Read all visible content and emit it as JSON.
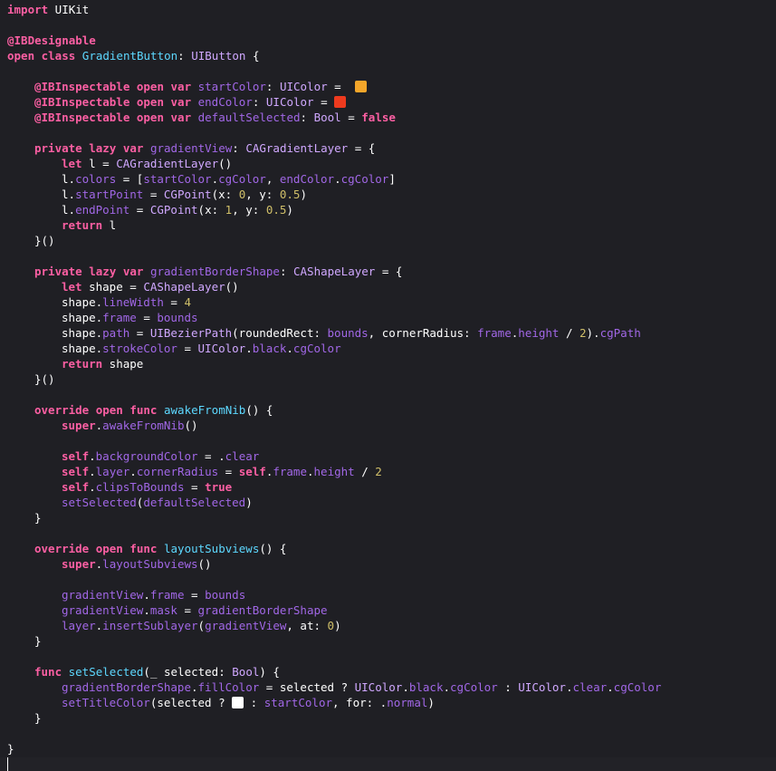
{
  "colors": {
    "start_swatch": "#f4a62a",
    "end_swatch": "#ee3a1e",
    "white_swatch": "#ffffff",
    "background": "#1f1f24"
  },
  "code": {
    "l1": {
      "kw": "import",
      "rest": " UIKit"
    },
    "l3": {
      "attr": "@IBDesignable"
    },
    "l4": {
      "kw": "open class",
      "cls": "GradientButton",
      "sep": ": ",
      "tp": "UIButton",
      "rest": " {"
    },
    "l6": {
      "attr": "@IBInspectable",
      "kw": " open var",
      "prop": " startColor",
      "sep": ": ",
      "tp": "UIColor",
      "rest": " = "
    },
    "l7": {
      "attr": "@IBInspectable",
      "kw": " open var",
      "prop": " endColor",
      "sep": ": ",
      "tp": "UIColor",
      "rest": " = "
    },
    "l8": {
      "attr": "@IBInspectable",
      "kw": " open var",
      "prop": " defaultSelected",
      "sep": ": ",
      "tp": "Bool",
      "eq": " = ",
      "kw2": "false"
    },
    "l10": {
      "kw": "private lazy var",
      "prop": " gradientView",
      "sep": ": ",
      "tp": "CAGradientLayer",
      "rest": " = {"
    },
    "l11": {
      "kw": "let",
      "rest": " l = ",
      "tp": "CAGradientLayer",
      "end": "()"
    },
    "l12": {
      "a": "l.",
      "prop": "colors",
      "b": " = [",
      "prop2": "startColor",
      "c": ".",
      "prop3": "cgColor",
      "d": ", ",
      "prop4": "endColor",
      "e": ".",
      "prop5": "cgColor",
      "f": "]"
    },
    "l13": {
      "a": "l.",
      "prop": "startPoint",
      "b": " = ",
      "tp": "CGPoint",
      "c": "(x: ",
      "n1": "0",
      "d": ", y: ",
      "n2": "0.5",
      "e": ")"
    },
    "l14": {
      "a": "l.",
      "prop": "endPoint",
      "b": " = ",
      "tp": "CGPoint",
      "c": "(x: ",
      "n1": "1",
      "d": ", y: ",
      "n2": "0.5",
      "e": ")"
    },
    "l15": {
      "kw": "return",
      "rest": " l"
    },
    "l16": {
      "rest": "}()"
    },
    "l18": {
      "kw": "private lazy var",
      "prop": " gradientBorderShape",
      "sep": ": ",
      "tp": "CAShapeLayer",
      "rest": " = {"
    },
    "l19": {
      "kw": "let",
      "rest": " shape = ",
      "tp": "CAShapeLayer",
      "end": "()"
    },
    "l20": {
      "a": "shape.",
      "prop": "lineWidth",
      "b": " = ",
      "n1": "4"
    },
    "l21": {
      "a": "shape.",
      "prop": "frame",
      "b": " = ",
      "prop2": "bounds"
    },
    "l22": {
      "a": "shape.",
      "prop": "path",
      "b": " = ",
      "tp": "UIBezierPath",
      "c": "(roundedRect: ",
      "prop2": "bounds",
      "d": ", cornerRadius: ",
      "prop3": "frame",
      "e": ".",
      "prop4": "height",
      "f": " / ",
      "n1": "2",
      "g": ").",
      "prop5": "cgPath"
    },
    "l23": {
      "a": "shape.",
      "prop": "strokeColor",
      "b": " = ",
      "tp": "UIColor",
      "c": ".",
      "prop2": "black",
      "d": ".",
      "prop3": "cgColor"
    },
    "l24": {
      "kw": "return",
      "rest": " shape"
    },
    "l25": {
      "rest": "}()"
    },
    "l27": {
      "kw": "override open func",
      "cls": " awakeFromNib",
      "rest": "() {"
    },
    "l28": {
      "kw": "super",
      "a": ".",
      "prop": "awakeFromNib",
      "b": "()"
    },
    "l30": {
      "kw": "self",
      "a": ".",
      "prop": "backgroundColor",
      "b": " = .",
      "prop2": "clear"
    },
    "l31": {
      "kw": "self",
      "a": ".",
      "prop": "layer",
      "b": ".",
      "prop2": "cornerRadius",
      "c": " = ",
      "kw2": "self",
      "d": ".",
      "prop3": "frame",
      "e": ".",
      "prop4": "height",
      "f": " / ",
      "n1": "2"
    },
    "l32": {
      "kw": "self",
      "a": ".",
      "prop": "clipsToBounds",
      "b": " = ",
      "kw2": "true"
    },
    "l33": {
      "prop": "setSelected",
      "a": "(",
      "prop2": "defaultSelected",
      "b": ")"
    },
    "l34": {
      "rest": "}"
    },
    "l36": {
      "kw": "override open func",
      "cls": " layoutSubviews",
      "rest": "() {"
    },
    "l37": {
      "kw": "super",
      "a": ".",
      "prop": "layoutSubviews",
      "b": "()"
    },
    "l39": {
      "prop": "gradientView",
      "a": ".",
      "prop2": "frame",
      "b": " = ",
      "prop3": "bounds"
    },
    "l40": {
      "prop": "gradientView",
      "a": ".",
      "prop2": "mask",
      "b": " = ",
      "prop3": "gradientBorderShape"
    },
    "l41": {
      "prop": "layer",
      "a": ".",
      "prop2": "insertSublayer",
      "b": "(",
      "prop3": "gradientView",
      "c": ", at: ",
      "n1": "0",
      "d": ")"
    },
    "l42": {
      "rest": "}"
    },
    "l44": {
      "kw": "func",
      "cls": " setSelected",
      "a": "(_ selected: ",
      "tp": "Bool",
      "rest": ") {"
    },
    "l45": {
      "prop": "gradientBorderShape",
      "a": ".",
      "prop2": "fillColor",
      "b": " = selected ? ",
      "tp": "UIColor",
      "c": ".",
      "prop3": "black",
      "d": ".",
      "prop4": "cgColor",
      "e": " : ",
      "tp2": "UIColor",
      "f": ".",
      "prop5": "clear",
      "g": ".",
      "prop6": "cgColor"
    },
    "l46a": {
      "prop": "setTitleColor",
      "a": "(selected ? "
    },
    "l46b": {
      "b": " : ",
      "prop2": "startColor",
      "c": ", for: .",
      "prop3": "normal",
      "d": ")"
    },
    "l47": {
      "rest": "}"
    },
    "l49": {
      "rest": "}"
    }
  }
}
